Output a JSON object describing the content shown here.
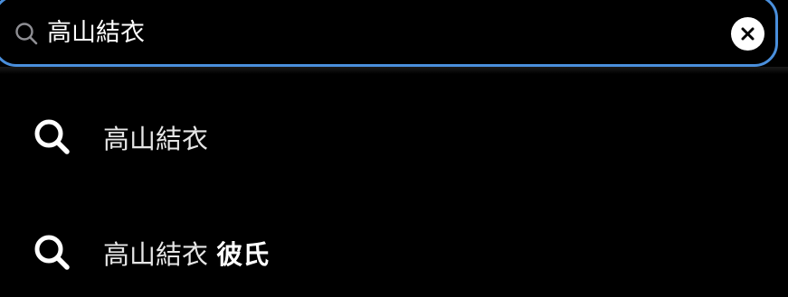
{
  "search": {
    "query": "高山結衣",
    "clear_icon": "close-icon",
    "search_icon": "search-icon",
    "accent_color": "#4a8fdc"
  },
  "suggestions": [
    {
      "prefix": "高山結衣",
      "completion": ""
    },
    {
      "prefix": "高山結衣",
      "completion": "彼氏"
    }
  ]
}
